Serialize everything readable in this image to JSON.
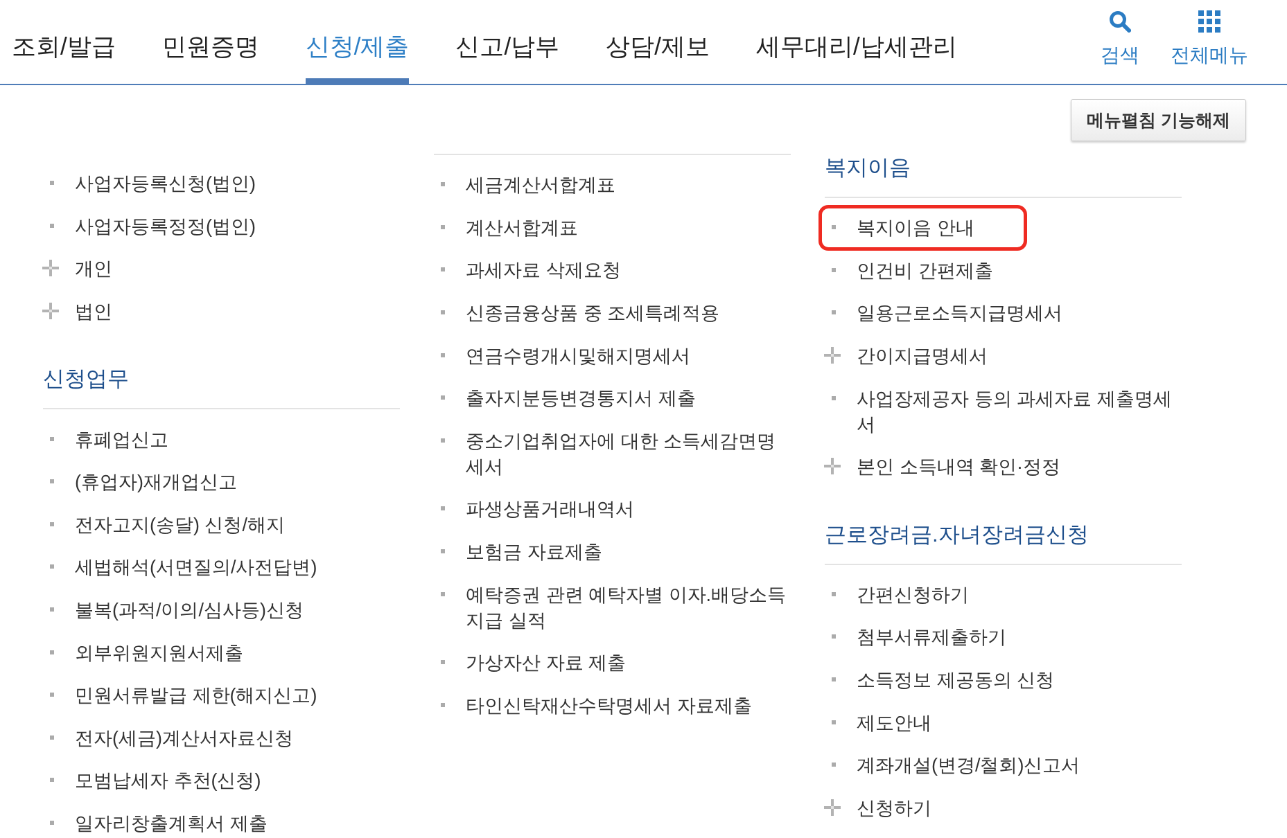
{
  "nav": {
    "tabs": [
      {
        "label": "조회/발급",
        "selected": false
      },
      {
        "label": "민원증명",
        "selected": false
      },
      {
        "label": "신청/제출",
        "selected": true
      },
      {
        "label": "신고/납부",
        "selected": false
      },
      {
        "label": "상담/제보",
        "selected": false
      },
      {
        "label": "세무대리/납세관리",
        "selected": false
      }
    ],
    "tools": [
      {
        "kind": "search",
        "label": "검색"
      },
      {
        "kind": "all_menu",
        "label": "전체메뉴"
      }
    ]
  },
  "menu_toggle": {
    "label": "메뉴펼침 기능해제"
  },
  "columns": [
    {
      "sections": [
        {
          "items": [
            {
              "label": "사업자등록신청(법인)",
              "kind": "page"
            },
            {
              "label": "사업자등록정정(법인)",
              "kind": "page"
            },
            {
              "label": "개인",
              "kind": "group"
            },
            {
              "label": "법인",
              "kind": "group"
            }
          ]
        },
        {
          "heading": "신청업무",
          "items": [
            {
              "label": "휴폐업신고",
              "kind": "page"
            },
            {
              "label": "(휴업자)재개업신고",
              "kind": "page"
            },
            {
              "label": "전자고지(송달) 신청/해지",
              "kind": "page"
            },
            {
              "label": "세법해석(서면질의/사전답변)",
              "kind": "page"
            },
            {
              "label": "불복(과적/이의/심사등)신청",
              "kind": "page"
            },
            {
              "label": "외부위원지원서제출",
              "kind": "page"
            },
            {
              "label": "민원서류발급 제한(해지신고)",
              "kind": "page"
            },
            {
              "label": "전자(세금)계산서자료신청",
              "kind": "page"
            },
            {
              "label": "모범납세자 추천(신청)",
              "kind": "page"
            },
            {
              "label": "일자리창출계획서 제출",
              "kind": "page"
            }
          ]
        }
      ]
    },
    {
      "sections": [
        {
          "items": [
            {
              "label": "세금계산서합계표",
              "kind": "page"
            },
            {
              "label": "계산서합계표",
              "kind": "page"
            },
            {
              "label": "과세자료 삭제요청",
              "kind": "page"
            },
            {
              "label": "신종금융상품 중 조세특례적용",
              "kind": "page"
            },
            {
              "label": "연금수령개시및해지명세서",
              "kind": "page"
            },
            {
              "label": "출자지분등변경통지서 제출",
              "kind": "page"
            },
            {
              "label": "중소기업취업자에 대한 소득세감면명세서",
              "kind": "page"
            },
            {
              "label": "파생상품거래내역서",
              "kind": "page"
            },
            {
              "label": "보험금 자료제출",
              "kind": "page"
            },
            {
              "label": "예탁증권 관련 예탁자별 이자.배당소득 지급 실적",
              "kind": "page"
            },
            {
              "label": "가상자산 자료 제출",
              "kind": "page"
            },
            {
              "label": "타인신탁재산수탁명세서 자료제출",
              "kind": "page"
            }
          ]
        }
      ]
    },
    {
      "sections": [
        {
          "heading": "복지이음",
          "items": [
            {
              "label": "복지이음 안내",
              "kind": "page",
              "highlighted": true
            },
            {
              "label": "인건비 간편제출",
              "kind": "page",
              "highlighted": false
            },
            {
              "label": "일용근로소득지급명세서",
              "kind": "page",
              "highlighted": false
            },
            {
              "label": "간이지급명세서",
              "kind": "group",
              "highlighted": false
            },
            {
              "label": "사업장제공자 등의 과세자료 제출명세서",
              "kind": "page",
              "highlighted": false
            },
            {
              "label": "본인 소득내역 확인·정정",
              "kind": "group",
              "highlighted": false
            }
          ]
        },
        {
          "heading": "근로장려금.자녀장려금신청",
          "items": [
            {
              "label": "간편신청하기",
              "kind": "page"
            },
            {
              "label": "첨부서류제출하기",
              "kind": "page"
            },
            {
              "label": "소득정보 제공동의 신청",
              "kind": "page"
            },
            {
              "label": "제도안내",
              "kind": "page"
            },
            {
              "label": "계좌개설(변경/철회)신고서",
              "kind": "page"
            },
            {
              "label": "신청하기",
              "kind": "group"
            }
          ]
        }
      ]
    }
  ]
}
